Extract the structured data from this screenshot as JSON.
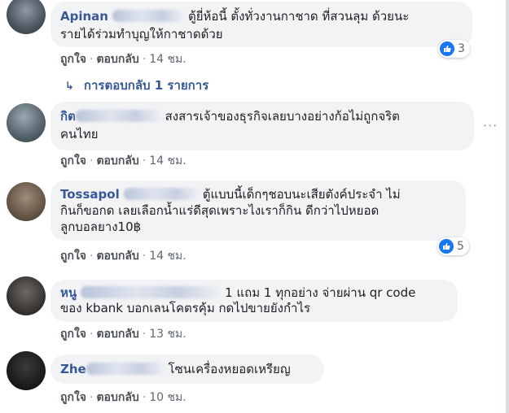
{
  "comments": [
    {
      "name_visible": "Apinan",
      "text_line1": "ตู้ยี่ห้อนี้ ตั้งทั่วงานกาชาด ที่สวนลุม ด้วยนะ",
      "text_line2": "รายได้ร่วมทำบุญให้กาชาดด้วย",
      "like": "ถูกใจ",
      "reply": "ตอบกลับ",
      "time": "14 ชม.",
      "reaction_count": "3"
    },
    {
      "name_visible": "กิต",
      "text_line1": "สงสารเจ้าของธุรกิจเลยบางอย่างก้อไม่ถูกจริต",
      "text_line2": "คนไทย",
      "like": "ถูกใจ",
      "reply": "ตอบกลับ",
      "time": "14 ชม."
    },
    {
      "name_visible": "Tossapol",
      "text_line1": "ตู้แบบนี้เด็กๆชอบนะเสียตังค์ประจำ ไม่",
      "text_line2": "กินก็ขอกด เลยเลือกน้ำแร่ดีสุดเพราะไงเราก็กิน ดีกว่าไปหยอด",
      "text_line3": "ลูกบอลยาง10฿",
      "like": "ถูกใจ",
      "reply": "ตอบกลับ",
      "time": "14 ชม.",
      "reaction_count": "5"
    },
    {
      "name_visible": "หนู",
      "text_line1": "1 แถม 1 ทุกอย่าง จ่ายผ่าน qr code",
      "text_line2": "ของ kbank บอกเลนโคตรคุ้ม กดไปขายยังกำไร",
      "like": "ถูกใจ",
      "reply": "ตอบกลับ",
      "time": "13 ชม."
    },
    {
      "name_visible": "Zhe",
      "text_line1": "โซนเครื่องหยอดเหรียญ",
      "like": "ถูกใจ",
      "reply": "ตอบกลับ",
      "time": "10 ชม."
    }
  ],
  "replies_link": "การตอบกลับ 1 รายการ",
  "colors": {
    "name": "#385898",
    "bubble": "#f2f3f5",
    "like_blue": "#1877f2"
  }
}
